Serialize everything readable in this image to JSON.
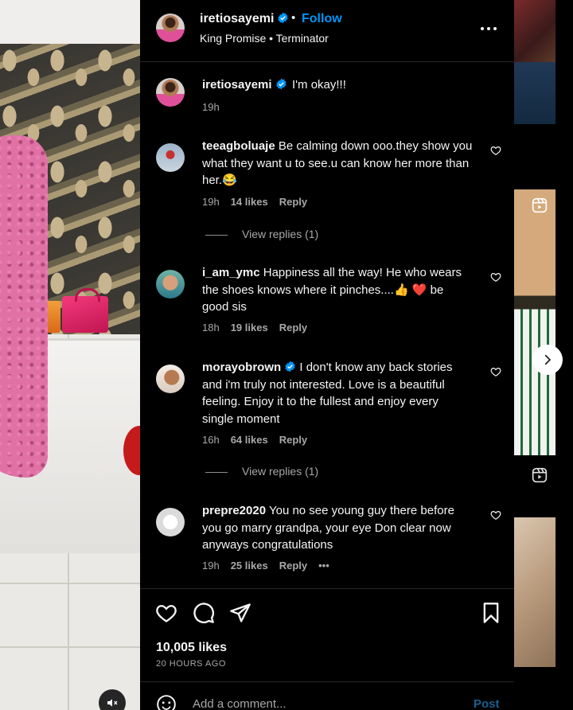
{
  "header": {
    "username": "iretiosayemi",
    "separator": "•",
    "follow_label": "Follow",
    "subtitle": "King Promise • Terminator",
    "more_icon": "more-horizontal-icon"
  },
  "caption": {
    "username": "iretiosayemi",
    "text": "I'm okay!!!",
    "time": "19h"
  },
  "comments": [
    {
      "username": "teeagboluaje",
      "text": "Be calming down ooo.they show you what they want u to see.u can know her more than her.😂",
      "time": "19h",
      "likes": "14 likes",
      "reply": "Reply",
      "view_replies": "View replies (1)"
    },
    {
      "username": "i_am_ymc",
      "text": "Happiness all the way! He who wears the shoes knows where it pinches....👍 ❤️ be good sis",
      "time": "18h",
      "likes": "19 likes",
      "reply": "Reply"
    },
    {
      "username": "morayobrown",
      "text": "I don't know any back stories and i'm truly not interested. Love is a beautiful feeling. Enjoy it to the fullest and enjoy every single moment",
      "time": "16h",
      "likes": "64 likes",
      "reply": "Reply",
      "view_replies": "View replies (1)"
    },
    {
      "username": "prepre2020",
      "text": "You no see young guy there before you go marry grandpa, your eye Don clear now anyways congratulations",
      "time": "19h",
      "likes": "25 likes",
      "reply": "Reply",
      "more": "•••"
    }
  ],
  "footer": {
    "likes": "10,005 likes",
    "time_ago": "20 HOURS AGO",
    "add_comment_placeholder": "Add a comment...",
    "post_label": "Post"
  },
  "colors": {
    "accent_blue": "#0095f6",
    "verified_blue": "#0095f6",
    "background": "#000000"
  }
}
